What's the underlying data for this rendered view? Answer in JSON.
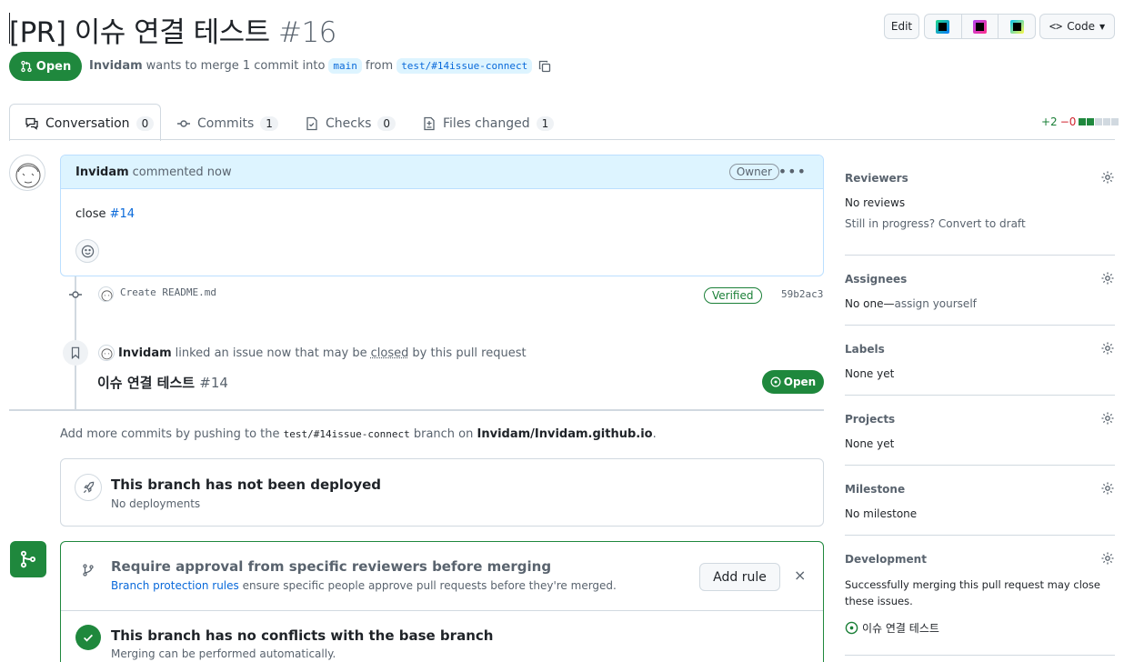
{
  "header": {
    "title": "[PR] 이슈 연결 테스트",
    "number": "#16",
    "edit_label": "Edit",
    "code_label": "Code",
    "ide_icons": [
      "jetbrains-icon",
      "phpstorm-icon",
      "webstorm-icon"
    ],
    "state_label": "Open",
    "author": "Invidam",
    "meta_text": "wants to merge 1 commit into",
    "base_branch": "main",
    "from_text": "from",
    "head_branch": "test/#14issue-connect"
  },
  "tabs": [
    {
      "label": "Conversation",
      "count": "0",
      "icon": "comment-discussion-icon"
    },
    {
      "label": "Commits",
      "count": "1",
      "icon": "commit-icon"
    },
    {
      "label": "Checks",
      "count": "0",
      "icon": "checklist-icon"
    },
    {
      "label": "Files changed",
      "count": "1",
      "icon": "file-diff-icon"
    }
  ],
  "diffstat": {
    "added": "+2",
    "removed": "−0",
    "blocks": [
      "green",
      "green",
      "gray",
      "gray",
      "gray"
    ]
  },
  "comment": {
    "author": "Invidam",
    "time": "commented now",
    "badge": "Owner",
    "body_text": "close",
    "body_link": "#14"
  },
  "timeline": {
    "commit_message": "Create README.md",
    "verified": "Verified",
    "sha": "59b2ac3",
    "linked_author": "Invidam",
    "linked_text_a": "linked an issue now that may be",
    "linked_closed": "closed",
    "linked_text_b": "by this pull request",
    "issue_title": "이슈 연결 테스트",
    "issue_number": "#14",
    "issue_state": "Open"
  },
  "push_hint": {
    "prefix": "Add more commits by pushing to the",
    "branch": "test/#14issue-connect",
    "middle": "branch on",
    "repo": "Invidam/Invidam.github.io",
    "suffix": "."
  },
  "deploy": {
    "title": "This branch has not been deployed",
    "subtitle": "No deployments"
  },
  "merge": {
    "rule_title": "Require approval from specific reviewers before merging",
    "rule_link": "Branch protection rules",
    "rule_text": "ensure specific people approve pull requests before they're merged.",
    "add_rule": "Add rule",
    "close": "×",
    "conflict_title": "This branch has no conflicts with the base branch",
    "conflict_sub": "Merging can be performed automatically."
  },
  "sidebar": {
    "reviewers": {
      "title": "Reviewers",
      "line1": "No reviews",
      "line2_a": "Still in progress?",
      "line2_b": "Convert to draft"
    },
    "assignees": {
      "title": "Assignees",
      "line_a": "No one—",
      "line_b": "assign yourself"
    },
    "labels": {
      "title": "Labels",
      "line": "None yet"
    },
    "projects": {
      "title": "Projects",
      "line": "None yet"
    },
    "milestone": {
      "title": "Milestone",
      "line": "No milestone"
    },
    "development": {
      "title": "Development",
      "text": "Successfully merging this pull request may close these issues.",
      "issue": "이슈 연결 테스트"
    }
  },
  "colors": {
    "green": "#1f883d",
    "blue": "#0969da",
    "muted": "#59636e",
    "border": "#d1d9e0"
  }
}
